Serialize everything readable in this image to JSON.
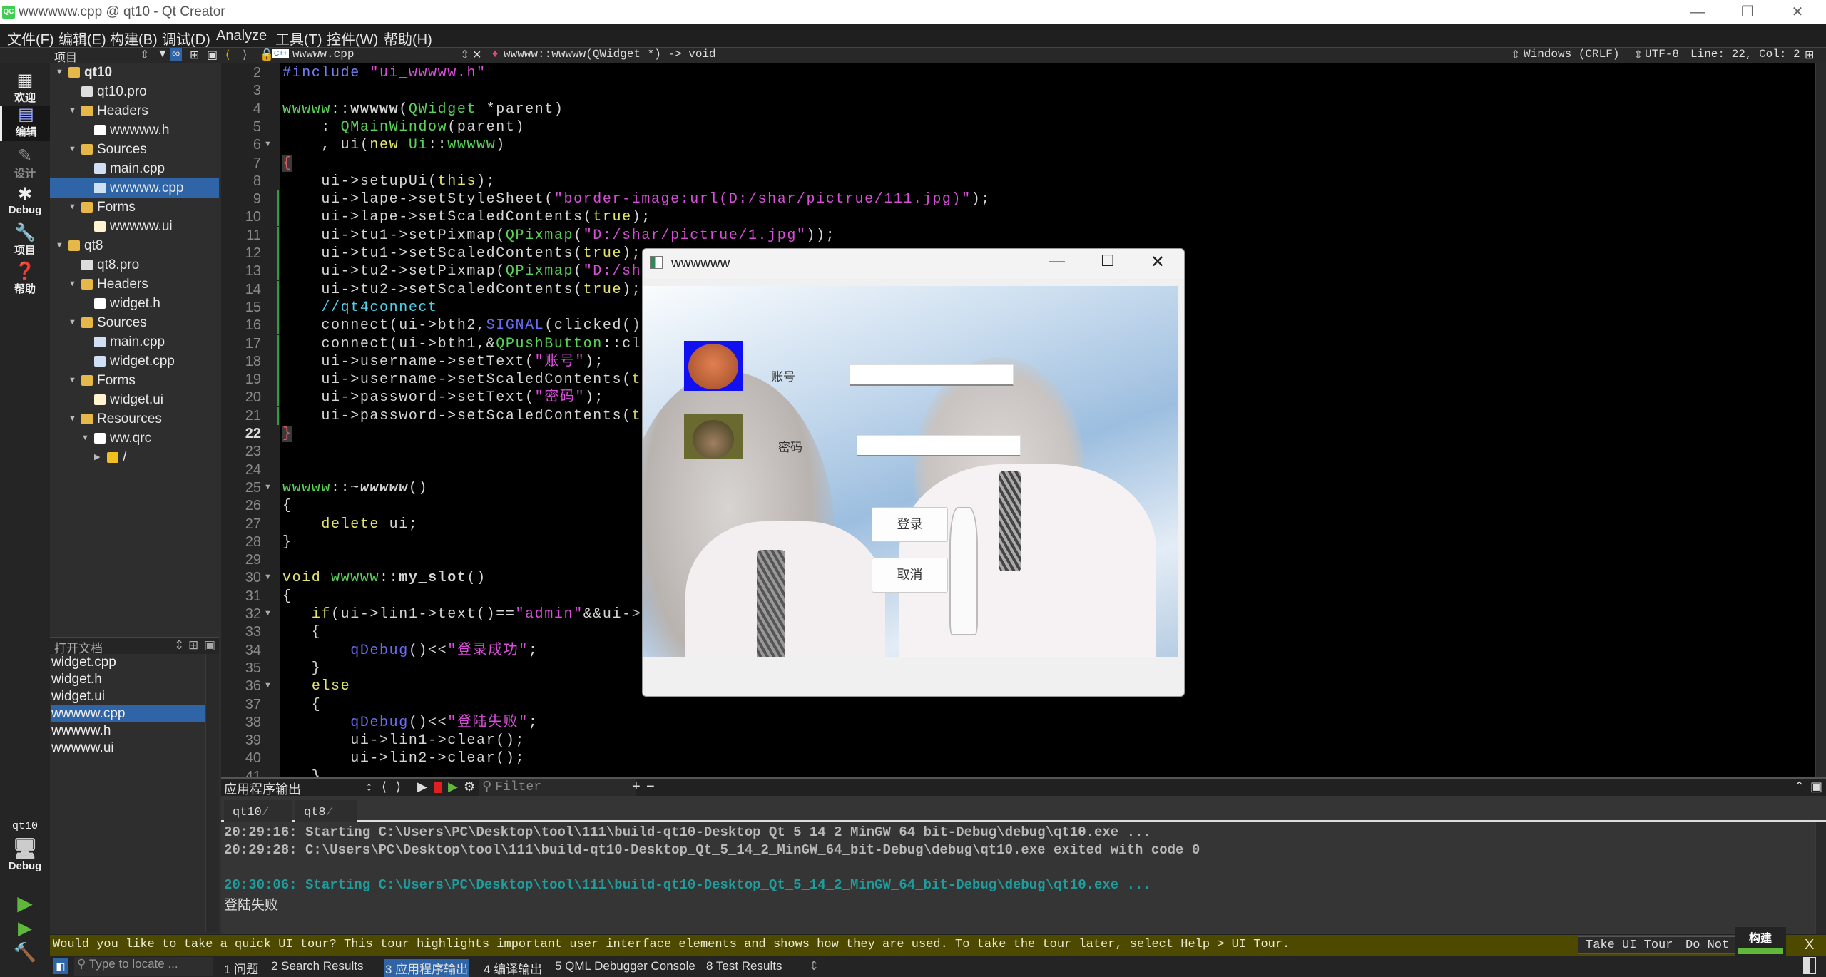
{
  "window": {
    "title": "wwwwww.cpp @ qt10 - Qt Creator",
    "logo": "QC",
    "controls": [
      "minimize",
      "maximize",
      "close"
    ]
  },
  "menu": [
    "文件(F)",
    "编辑(E)",
    "构建(B)",
    "调试(D)",
    "Analyze",
    "工具(T)",
    "控件(W)",
    "帮助(H)"
  ],
  "toolbar": {
    "panel_title": "项目",
    "file_name": "wwwww.cpp",
    "symbol": "wwwww::wwwww(QWidget *) -> void",
    "line_ending": "Windows (CRLF)",
    "encoding": "UTF-8",
    "cursor": "Line: 22, Col: 2"
  },
  "modes": [
    {
      "label": "欢迎",
      "icon": "grid-icon"
    },
    {
      "label": "编辑",
      "icon": "edit-icon",
      "active": true
    },
    {
      "label": "设计",
      "icon": "pencil-icon"
    },
    {
      "label": "Debug",
      "icon": "bug-icon"
    },
    {
      "label": "项目",
      "icon": "wrench-icon"
    },
    {
      "label": "帮助",
      "icon": "help-icon"
    }
  ],
  "kit": {
    "project": "qt10",
    "config": "Debug"
  },
  "tree": [
    {
      "label": "qt10",
      "level": 0,
      "icon": "qt-project",
      "expanded": true,
      "bold": true
    },
    {
      "label": "qt10.pro",
      "level": 1,
      "icon": "pro-file"
    },
    {
      "label": "Headers",
      "level": 1,
      "icon": "folder-h",
      "expanded": true
    },
    {
      "label": "wwwww.h",
      "level": 2,
      "icon": "h-file"
    },
    {
      "label": "Sources",
      "level": 1,
      "icon": "folder-cpp",
      "expanded": true
    },
    {
      "label": "main.cpp",
      "level": 2,
      "icon": "cpp-file"
    },
    {
      "label": "wwwww.cpp",
      "level": 2,
      "icon": "cpp-file",
      "selected": true
    },
    {
      "label": "Forms",
      "level": 1,
      "icon": "folder-ui",
      "expanded": true
    },
    {
      "label": "wwwww.ui",
      "level": 2,
      "icon": "ui-file"
    },
    {
      "label": "qt8",
      "level": 0,
      "icon": "qt-project",
      "expanded": true
    },
    {
      "label": "qt8.pro",
      "level": 1,
      "icon": "pro-file"
    },
    {
      "label": "Headers",
      "level": 1,
      "icon": "folder-h",
      "expanded": true
    },
    {
      "label": "widget.h",
      "level": 2,
      "icon": "h-file"
    },
    {
      "label": "Sources",
      "level": 1,
      "icon": "folder-cpp",
      "expanded": true
    },
    {
      "label": "main.cpp",
      "level": 2,
      "icon": "cpp-file"
    },
    {
      "label": "widget.cpp",
      "level": 2,
      "icon": "cpp-file"
    },
    {
      "label": "Forms",
      "level": 1,
      "icon": "folder-ui",
      "expanded": true
    },
    {
      "label": "widget.ui",
      "level": 2,
      "icon": "ui-file"
    },
    {
      "label": "Resources",
      "level": 1,
      "icon": "folder-res",
      "expanded": true
    },
    {
      "label": "ww.qrc",
      "level": 2,
      "icon": "qrc-file",
      "expanded": true
    },
    {
      "label": "/",
      "level": 3,
      "icon": "folder",
      "expanded": false
    }
  ],
  "open_docs": {
    "title": "打开文档",
    "items": [
      "widget.cpp",
      "widget.h",
      "widget.ui",
      "wwwww.cpp",
      "wwwww.h",
      "wwwww.ui"
    ],
    "selected": 3
  },
  "editor": {
    "current_line": 22,
    "fold_lines": [
      6,
      25,
      30,
      32,
      36
    ],
    "changed_lines": [
      9,
      10,
      11,
      12,
      13,
      14,
      15,
      16,
      17,
      18,
      19,
      20,
      21
    ],
    "lines": [
      {
        "n": 2,
        "tokens": [
          [
            "#include",
            "pp"
          ],
          [
            " \"ui_wwwww.h\"",
            "s"
          ]
        ]
      },
      {
        "n": 3,
        "tokens": []
      },
      {
        "n": 4,
        "tokens": [
          [
            "wwwww",
            "ty"
          ],
          [
            "::",
            ""
          ],
          [
            "wwwww",
            "b"
          ],
          [
            "(",
            ""
          ],
          [
            "QWidget",
            "ty"
          ],
          [
            " *parent)",
            ""
          ]
        ]
      },
      {
        "n": 5,
        "tokens": [
          [
            "    : ",
            ""
          ],
          [
            "QMainWindow",
            "ty"
          ],
          [
            "(parent)",
            ""
          ]
        ]
      },
      {
        "n": 6,
        "tokens": [
          [
            "    , ui(",
            ""
          ],
          [
            "new",
            "k"
          ],
          [
            " ",
            ""
          ],
          [
            "Ui",
            "ty"
          ],
          [
            "::",
            ""
          ],
          [
            "wwwww",
            "ty"
          ],
          [
            ")",
            ""
          ]
        ]
      },
      {
        "n": 7,
        "tokens": [
          [
            "{",
            "br"
          ]
        ]
      },
      {
        "n": 8,
        "tokens": [
          [
            "    ui->setupUi(",
            ""
          ],
          [
            "this",
            "k"
          ],
          [
            ");",
            ""
          ]
        ]
      },
      {
        "n": 9,
        "tokens": [
          [
            "    ui->lape->setStyleSheet(",
            ""
          ],
          [
            "\"border-image:url(D:/shar/pictrue/111.jpg)\"",
            "s"
          ],
          [
            ");",
            ""
          ]
        ]
      },
      {
        "n": 10,
        "tokens": [
          [
            "    ui->lape->setScaledContents(",
            ""
          ],
          [
            "true",
            "k"
          ],
          [
            ");",
            ""
          ]
        ]
      },
      {
        "n": 11,
        "tokens": [
          [
            "    ui->tu1->setPixmap(",
            ""
          ],
          [
            "QPixmap",
            "ty"
          ],
          [
            "(",
            ""
          ],
          [
            "\"D:/shar/pictrue/1.jpg\"",
            "s"
          ],
          [
            "));",
            ""
          ]
        ]
      },
      {
        "n": 12,
        "tokens": [
          [
            "    ui->tu1->setScaledContents(",
            ""
          ],
          [
            "true",
            "k"
          ],
          [
            ");",
            ""
          ]
        ]
      },
      {
        "n": 13,
        "tokens": [
          [
            "    ui->tu2->setPixmap(",
            ""
          ],
          [
            "QPixmap",
            "ty"
          ],
          [
            "(",
            ""
          ],
          [
            "\"D:/shar/pi",
            "s"
          ]
        ]
      },
      {
        "n": 14,
        "tokens": [
          [
            "    ui->tu2->setScaledContents(",
            ""
          ],
          [
            "true",
            "k"
          ],
          [
            ");",
            ""
          ]
        ]
      },
      {
        "n": 15,
        "tokens": [
          [
            "    //qt4connect",
            "cm"
          ]
        ]
      },
      {
        "n": 16,
        "tokens": [
          [
            "    connect(ui->bth2,",
            ""
          ],
          [
            "SIGNAL",
            "fn"
          ],
          [
            "(clicked()),",
            ""
          ],
          [
            "thi",
            "k"
          ]
        ]
      },
      {
        "n": 17,
        "tokens": [
          [
            "    connect(ui->bth1,&",
            ""
          ],
          [
            "QPushButton",
            "ty"
          ],
          [
            "::clicked",
            ""
          ]
        ]
      },
      {
        "n": 18,
        "tokens": [
          [
            "    ui->username->setText(",
            ""
          ],
          [
            "\"账号\"",
            "s"
          ],
          [
            ");",
            ""
          ]
        ]
      },
      {
        "n": 19,
        "tokens": [
          [
            "    ui->username->setScaledContents(",
            ""
          ],
          [
            "true",
            "k"
          ],
          [
            ");",
            ""
          ]
        ]
      },
      {
        "n": 20,
        "tokens": [
          [
            "    ui->password->setText(",
            ""
          ],
          [
            "\"密码\"",
            "s"
          ],
          [
            ");",
            ""
          ]
        ]
      },
      {
        "n": 21,
        "tokens": [
          [
            "    ui->password->setScaledContents(",
            ""
          ],
          [
            "true",
            "k"
          ],
          [
            ");",
            ""
          ]
        ]
      },
      {
        "n": 22,
        "tokens": [
          [
            "}",
            "br"
          ]
        ]
      },
      {
        "n": 23,
        "tokens": []
      },
      {
        "n": 24,
        "tokens": []
      },
      {
        "n": 25,
        "tokens": [
          [
            "wwwww",
            "ty"
          ],
          [
            "::~",
            ""
          ],
          [
            "wwwww",
            "i"
          ],
          [
            "()",
            ""
          ]
        ]
      },
      {
        "n": 26,
        "tokens": [
          [
            "{",
            ""
          ]
        ]
      },
      {
        "n": 27,
        "tokens": [
          [
            "    ",
            ""
          ],
          [
            "delete",
            "k"
          ],
          [
            " ui;",
            ""
          ]
        ]
      },
      {
        "n": 28,
        "tokens": [
          [
            "}",
            ""
          ]
        ]
      },
      {
        "n": 29,
        "tokens": []
      },
      {
        "n": 30,
        "tokens": [
          [
            "void",
            "k"
          ],
          [
            " ",
            ""
          ],
          [
            "wwwww",
            "ty"
          ],
          [
            "::",
            ""
          ],
          [
            "my_slot",
            "b"
          ],
          [
            "()",
            ""
          ]
        ]
      },
      {
        "n": 31,
        "tokens": [
          [
            "{",
            ""
          ]
        ]
      },
      {
        "n": 32,
        "tokens": [
          [
            "   ",
            ""
          ],
          [
            "if",
            "k"
          ],
          [
            "(ui->lin1->text()==",
            ""
          ],
          [
            "\"admin\"",
            "s"
          ],
          [
            "&&ui->lin2-",
            ""
          ]
        ]
      },
      {
        "n": 33,
        "tokens": [
          [
            "   {",
            ""
          ]
        ]
      },
      {
        "n": 34,
        "tokens": [
          [
            "       ",
            ""
          ],
          [
            "qDebug",
            "fn"
          ],
          [
            "()<<",
            ""
          ],
          [
            "\"登录成功\"",
            "s"
          ],
          [
            ";",
            ""
          ]
        ]
      },
      {
        "n": 35,
        "tokens": [
          [
            "   }",
            ""
          ]
        ]
      },
      {
        "n": 36,
        "tokens": [
          [
            "   ",
            ""
          ],
          [
            "else",
            "k"
          ]
        ]
      },
      {
        "n": 37,
        "tokens": [
          [
            "   {",
            ""
          ]
        ]
      },
      {
        "n": 38,
        "tokens": [
          [
            "       ",
            ""
          ],
          [
            "qDebug",
            "fn"
          ],
          [
            "()<<",
            ""
          ],
          [
            "\"登陆失败\"",
            "s"
          ],
          [
            ";",
            ""
          ]
        ]
      },
      {
        "n": 39,
        "tokens": [
          [
            "       ui->lin1->clear();",
            ""
          ]
        ]
      },
      {
        "n": 40,
        "tokens": [
          [
            "       ui->lin2->clear();",
            ""
          ]
        ]
      },
      {
        "n": 41,
        "tokens": [
          [
            "   }",
            ""
          ]
        ]
      }
    ]
  },
  "dialog": {
    "title": "wwwwww",
    "username_label": "账号",
    "password_label": "密码",
    "username_value": "",
    "password_value": "",
    "login_label": "登录",
    "cancel_label": "取消"
  },
  "output": {
    "title": "应用程序输出",
    "filter_placeholder": "Filter",
    "tabs": [
      "qt10",
      "qt8"
    ],
    "lines": [
      {
        "text": "20:29:16: Starting C:\\Users\\PC\\Desktop\\tool\\111\\build-qt10-Desktop_Qt_5_14_2_MinGW_64_bit-Debug\\debug\\qt10.exe ...",
        "color": "#b8b8b8"
      },
      {
        "text": "20:29:28: C:\\Users\\PC\\Desktop\\tool\\111\\build-qt10-Desktop_Qt_5_14_2_MinGW_64_bit-Debug\\debug\\qt10.exe exited with code 0",
        "color": "#b8b8b8"
      },
      {
        "text": "20:30:06: Starting C:\\Users\\PC\\Desktop\\tool\\111\\build-qt10-Desktop_Qt_5_14_2_MinGW_64_bit-Debug\\debug\\qt10.exe ...",
        "color": "#1f9c9c"
      },
      {
        "text": "登陆失败",
        "color": "#dddddd"
      }
    ]
  },
  "tour": {
    "message": "Would you like to take a quick UI tour? This tour highlights important user interface elements and shows how they are used. To take the tour later, select Help > UI Tour.",
    "take_label": "Take UI Tour",
    "dismiss_label": "Do Not Show Again",
    "close_label": "X"
  },
  "build_progress": {
    "label": "构建",
    "value": 1.0,
    "color": "#5fb83a"
  },
  "statusbar": {
    "locate_placeholder": "Type to locate ...",
    "tabs": [
      "1 问题",
      "2 Search Results",
      "3 应用程序输出",
      "4 编译输出",
      "5 QML Debugger Console",
      "8 Test Results"
    ],
    "active_tab": 2
  }
}
